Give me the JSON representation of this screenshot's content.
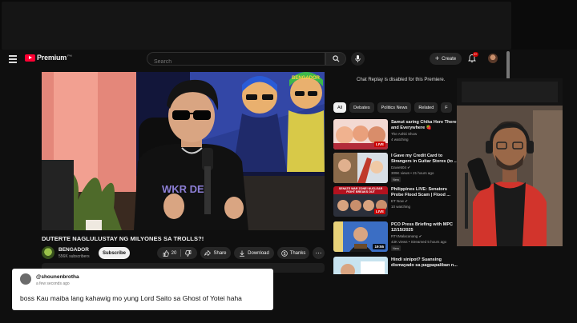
{
  "masthead": {
    "logo_text": "Premium",
    "logo_sup": "PH",
    "search_placeholder": "Search",
    "create_label": "Create",
    "notification_count": "9+"
  },
  "video": {
    "title": "DUTERTE NAGLULUSTAY NG MILYONES SA TROLLS?!",
    "channel": "BENGADOR",
    "subscribers": "556K subscribers",
    "subscribe_label": "Subscribe",
    "likes": "20",
    "share_label": "Share",
    "download_label": "Download",
    "thanks_label": "Thanks",
    "scene_shirt_text": "WKR DES",
    "scene_cap_text": "BENGADOR"
  },
  "chat": {
    "notice": "Chat Replay is disabled for this Premiere."
  },
  "chips": [
    "All",
    "Debates",
    "Politics News",
    "Related",
    "F"
  ],
  "recommendations": [
    {
      "title": "Samut saring Chika Here There and Everywhere 🍓",
      "channel": "The Ashki Show",
      "views": "4 watching",
      "badge": "LIVE",
      "is_new": false
    },
    {
      "title": "I Gave my Credit Card to Strangers in Guitar Stores (to ...",
      "channel": "Davie504 ✔",
      "views": "309K views • 21 hours ago",
      "badge": "",
      "is_new": true,
      "new_label": "New"
    },
    {
      "title": "Philippines LIVE: Senators Probe Flood Scam | Flood ...",
      "channel": "ET Now ✔",
      "views": "10 watching",
      "badge": "LIVE",
      "thumb_caption": "SENATE WAR ZONE! NUCLEAR FIGHT BREAKS OUT",
      "is_new": false
    },
    {
      "title": "PCO Press Briefing with MPC 12/15/2025",
      "channel": "RTVMalacanang ✔",
      "views": "43K views • Streamed 5 hours ago",
      "badge": "19:55",
      "is_new": true,
      "new_label": "New"
    },
    {
      "title": "Hindi sinipot? Suansing dismayado sa pagpapaliban n...",
      "channel": "",
      "views": "",
      "badge": "",
      "is_new": false
    }
  ],
  "comment": {
    "username": "@shounenbrotha",
    "time": "a few seconds ago",
    "text": "boss Kau maiba lang kahawig mo yung Lord Saito sa Ghost of Yotei haha"
  }
}
